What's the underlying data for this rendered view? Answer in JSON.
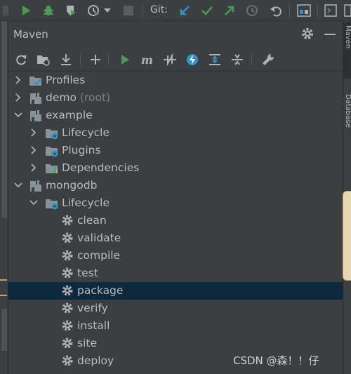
{
  "toolbar": {
    "git_label": "Git:"
  },
  "maven_panel": {
    "title": "Maven"
  },
  "right_stripe": {
    "tab_maven": "Maven",
    "tab_database": "Database"
  },
  "tree": {
    "items": [
      {
        "label": "Profiles",
        "suffix": ""
      },
      {
        "label": "demo",
        "suffix": " (root)"
      },
      {
        "label": "example",
        "suffix": ""
      },
      {
        "label": "Lifecycle",
        "suffix": ""
      },
      {
        "label": "Plugins",
        "suffix": ""
      },
      {
        "label": "Dependencies",
        "suffix": ""
      },
      {
        "label": "mongodb",
        "suffix": ""
      },
      {
        "label": "Lifecycle",
        "suffix": ""
      },
      {
        "label": "clean",
        "suffix": ""
      },
      {
        "label": "validate",
        "suffix": ""
      },
      {
        "label": "compile",
        "suffix": ""
      },
      {
        "label": "test",
        "suffix": ""
      },
      {
        "label": "package",
        "suffix": ""
      },
      {
        "label": "verify",
        "suffix": ""
      },
      {
        "label": "install",
        "suffix": ""
      },
      {
        "label": "site",
        "suffix": ""
      },
      {
        "label": "deploy",
        "suffix": ""
      }
    ]
  },
  "watermark": "CSDN @森！！仔",
  "colors": {
    "background": "#3c3f41",
    "selection": "#0d293e",
    "run_green": "#499c54",
    "git_blue": "#3592c4",
    "lifecycle_blue": "#3592c4",
    "text": "#bbbbbb"
  }
}
